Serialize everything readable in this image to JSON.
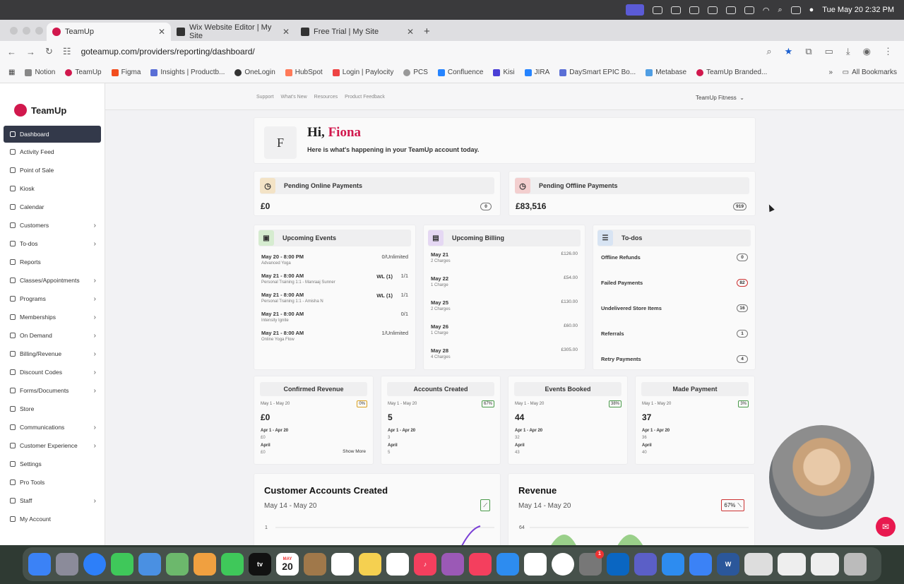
{
  "menubar": {
    "datetime": "Tue May 20  2:32 PM"
  },
  "browser": {
    "tabs": [
      {
        "label": "TeamUp",
        "active": true
      },
      {
        "label": "Wix Website Editor | My Site",
        "active": false
      },
      {
        "label": "Free Trial | My Site",
        "active": false
      }
    ],
    "url": "goteamup.com/providers/reporting/dashboard/",
    "bookmarks": [
      "Notion",
      "TeamUp",
      "Figma",
      "Insights | Productb...",
      "OneLogin",
      "HubSpot",
      "Login | Paylocity",
      "PCS",
      "Confluence",
      "Kisi",
      "JIRA",
      "DaySmart EPIC Bo...",
      "Metabase",
      "TeamUp Branded..."
    ],
    "all_bookmarks": "All Bookmarks"
  },
  "brand": {
    "name": "TeamUp",
    "accent": "#d1184d"
  },
  "sidebar": {
    "items": [
      {
        "label": "Dashboard",
        "active": true,
        "chevron": false
      },
      {
        "label": "Activity Feed",
        "chevron": false
      },
      {
        "label": "Point of Sale",
        "chevron": false
      },
      {
        "label": "Kiosk",
        "chevron": false
      },
      {
        "label": "Calendar",
        "chevron": false
      },
      {
        "label": "Customers",
        "chevron": true
      },
      {
        "label": "To-dos",
        "chevron": true
      },
      {
        "label": "Reports",
        "chevron": false
      },
      {
        "label": "Classes/Appointments",
        "chevron": true
      },
      {
        "label": "Programs",
        "chevron": true
      },
      {
        "label": "Memberships",
        "chevron": true
      },
      {
        "label": "On Demand",
        "chevron": true
      },
      {
        "label": "Billing/Revenue",
        "chevron": true
      },
      {
        "label": "Discount Codes",
        "chevron": true
      },
      {
        "label": "Forms/Documents",
        "chevron": true
      },
      {
        "label": "Store",
        "chevron": false
      },
      {
        "label": "Communications",
        "chevron": true
      },
      {
        "label": "Customer Experience",
        "chevron": true
      },
      {
        "label": "Settings",
        "chevron": false
      },
      {
        "label": "Pro Tools",
        "chevron": false
      },
      {
        "label": "Staff",
        "chevron": true
      },
      {
        "label": "My Account",
        "chevron": false
      }
    ]
  },
  "topnav": {
    "links": [
      "Support",
      "What's New",
      "Resources",
      "Product Feedback"
    ],
    "account": "TeamUp Fitness"
  },
  "welcome": {
    "initial": "F",
    "greeting": "Hi,",
    "name": "Fiona",
    "subtitle": "Here is what's happening in your TeamUp account today."
  },
  "payments": {
    "online": {
      "title": "Pending Online Payments",
      "amount": "£0",
      "count": "0"
    },
    "offline": {
      "title": "Pending Offline Payments",
      "amount": "£83,516",
      "count": "919"
    }
  },
  "events": {
    "title": "Upcoming Events",
    "items": [
      {
        "time": "May 20 - 8:00 PM",
        "name": "Advanced Yoga",
        "wl": "",
        "cap": "0/Unlimited"
      },
      {
        "time": "May 21 - 8:00 AM",
        "name": "Personal Training 1:1 - Manraaj Sunner",
        "wl": "WL (1)",
        "cap": "1/1"
      },
      {
        "time": "May 21 - 8:00 AM",
        "name": "Personal Training 1:1 - Amisha N",
        "wl": "WL (1)",
        "cap": "1/1"
      },
      {
        "time": "May 21 - 8:00 AM",
        "name": "Intensity Ignite",
        "wl": "",
        "cap": "0/1"
      },
      {
        "time": "May 21 - 8:00 AM",
        "name": "Online Yoga Flow",
        "wl": "",
        "cap": "1/Unlimited"
      }
    ]
  },
  "billing": {
    "title": "Upcoming Billing",
    "items": [
      {
        "date": "May 21",
        "charges": "2 Charges",
        "amount": "£126.00"
      },
      {
        "date": "May 22",
        "charges": "1 Charge",
        "amount": "£54.00"
      },
      {
        "date": "May 25",
        "charges": "2 Charges",
        "amount": "£130.00"
      },
      {
        "date": "May 26",
        "charges": "1 Charge",
        "amount": "£60.00"
      },
      {
        "date": "May 28",
        "charges": "4 Charges",
        "amount": "£305.00"
      }
    ]
  },
  "todos": {
    "title": "To-dos",
    "items": [
      {
        "label": "Offline Refunds",
        "count": "0"
      },
      {
        "label": "Failed Payments",
        "count": "82"
      },
      {
        "label": "Undelivered Store Items",
        "count": "16"
      },
      {
        "label": "Referrals",
        "count": "1"
      },
      {
        "label": "Retry Payments",
        "count": "4"
      }
    ]
  },
  "stats": [
    {
      "title": "Confirmed Revenue",
      "range": "May 1 - May 20",
      "pct": "0%",
      "value": "£0",
      "prev_label": "Apr 1 - Apr 20",
      "prev": "£0",
      "april_label": "April",
      "april": "£0",
      "more": "Show More"
    },
    {
      "title": "Accounts Created",
      "range": "May 1 - May 20",
      "pct": "67%",
      "value": "5",
      "prev_label": "Apr 1 - Apr 20",
      "prev": "3",
      "april_label": "April",
      "april": "5"
    },
    {
      "title": "Events Booked",
      "range": "May 1 - May 20",
      "pct": "38%",
      "value": "44",
      "prev_label": "Apr 1 - Apr 20",
      "prev": "32",
      "april_label": "April",
      "april": "43"
    },
    {
      "title": "Made Payment",
      "range": "May 1 - May 20",
      "pct": "3%",
      "value": "37",
      "prev_label": "Apr 1 - Apr 20",
      "prev": "36",
      "april_label": "April",
      "april": "40"
    }
  ],
  "charts": {
    "accounts": {
      "title": "Customer Accounts Created",
      "range": "May 14 - May 20",
      "ytick": "1"
    },
    "revenue": {
      "title": "Revenue",
      "range": "May 14 - May 20",
      "pct": "67%",
      "ytick": "64"
    }
  },
  "dock": {
    "calendar_month": "MAY",
    "calendar_day": "20",
    "settings_badge": "1"
  }
}
